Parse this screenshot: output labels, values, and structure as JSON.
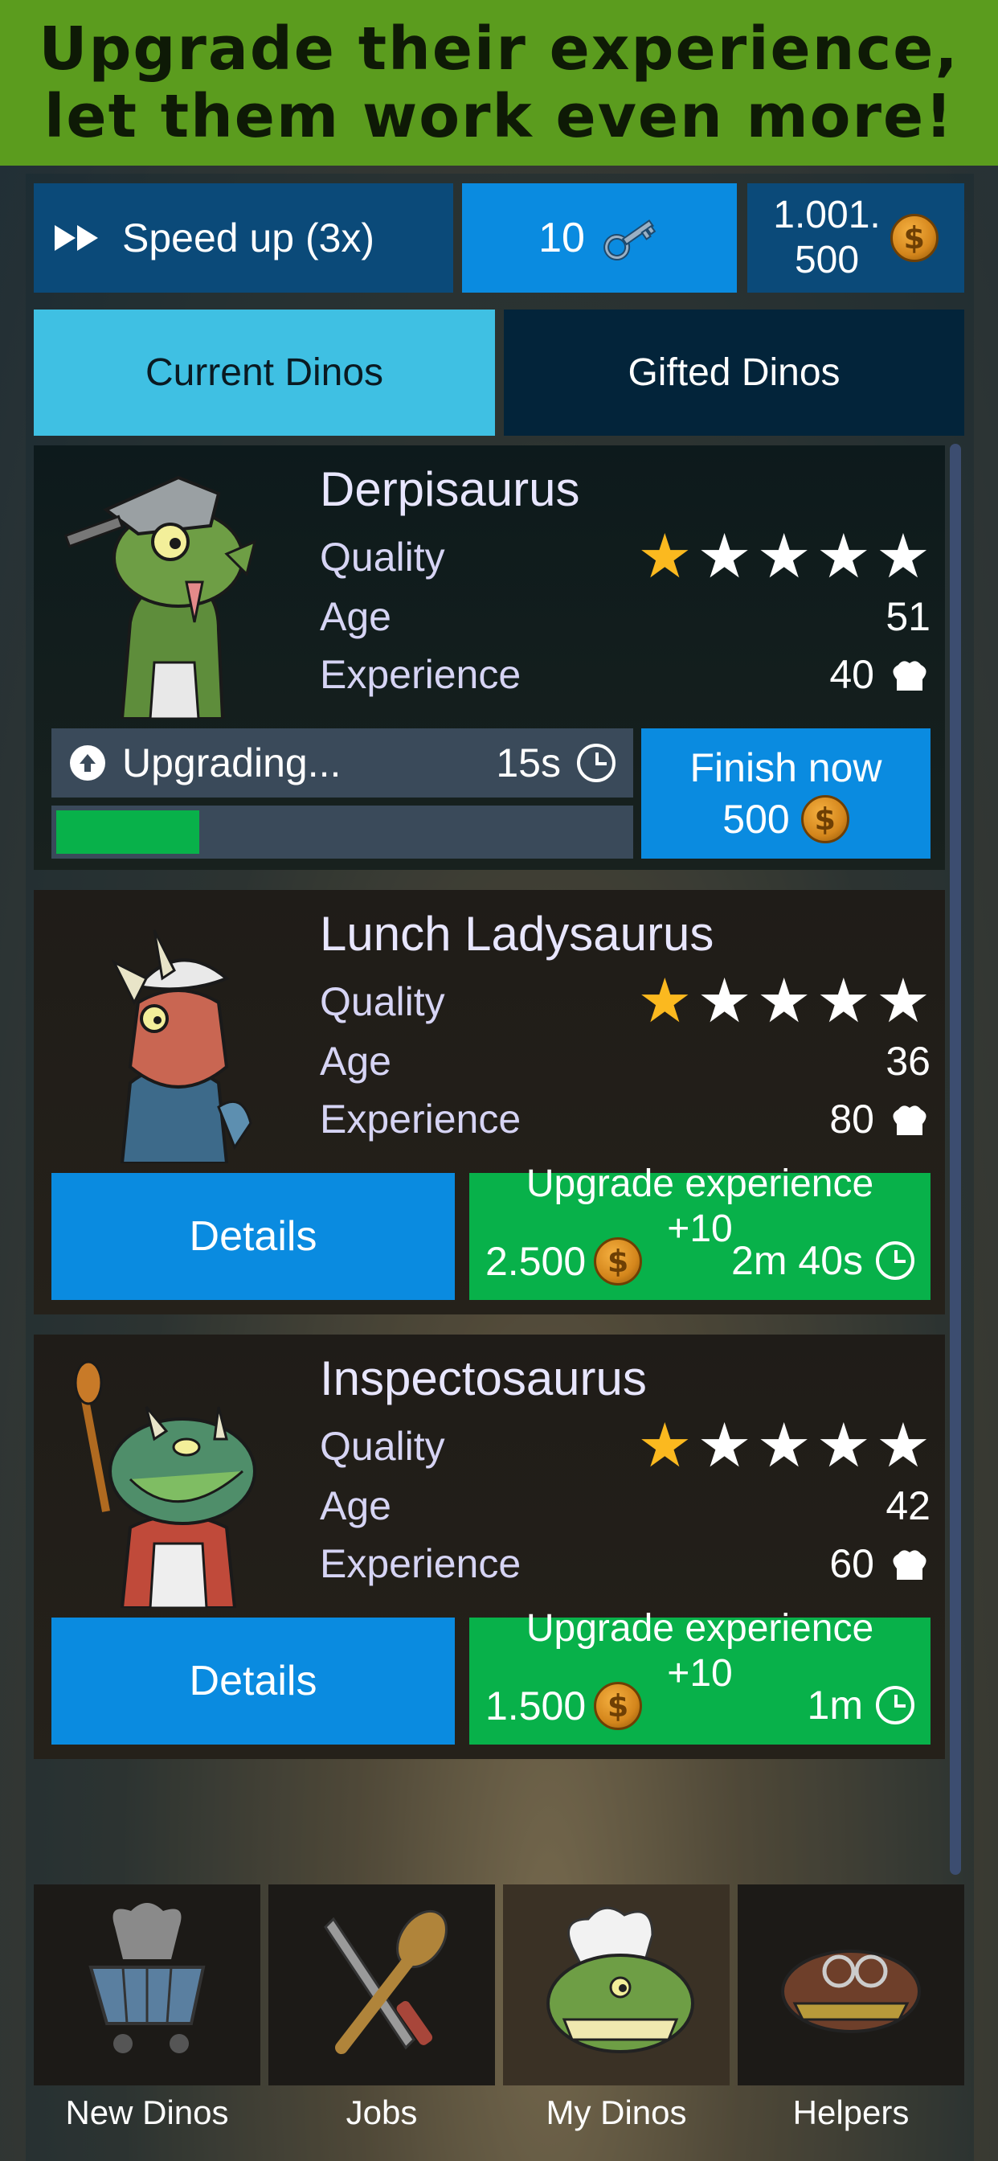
{
  "banner": {
    "line1": "Upgrade their experience,",
    "line2": "let them work even more!"
  },
  "topbar": {
    "speed_label": "Speed up (3x)",
    "keys_count": "10",
    "coins_line1": "1.001.",
    "coins_line2": "500"
  },
  "tabs": [
    {
      "label": "Current Dinos",
      "active": true
    },
    {
      "label": "Gifted Dinos",
      "active": false
    }
  ],
  "labels": {
    "quality": "Quality",
    "age": "Age",
    "experience": "Experience"
  },
  "dinos": [
    {
      "name": "Derpisaurus",
      "quality_stars": 1,
      "max_stars": 5,
      "age": "51",
      "experience": "40",
      "status": {
        "text": "Upgrading...",
        "time": "15s",
        "progress": 0.25
      },
      "finish": {
        "label": "Finish now",
        "cost": "500"
      }
    },
    {
      "name": "Lunch Ladysaurus",
      "quality_stars": 1,
      "max_stars": 5,
      "age": "36",
      "experience": "80",
      "details_label": "Details",
      "upgrade": {
        "title": "Upgrade experience",
        "plus": "+10",
        "cost": "2.500",
        "time": "2m 40s"
      }
    },
    {
      "name": "Inspectosaurus",
      "quality_stars": 1,
      "max_stars": 5,
      "age": "42",
      "experience": "60",
      "details_label": "Details",
      "upgrade": {
        "title": "Upgrade experience",
        "plus": "+10",
        "cost": "1.500",
        "time": "1m"
      }
    }
  ],
  "nav": [
    {
      "label": "New Dinos",
      "icon": "cart-icon"
    },
    {
      "label": "Jobs",
      "icon": "knife-spoon-icon"
    },
    {
      "label": "My Dinos",
      "icon": "dino-chef-icon",
      "active": true
    },
    {
      "label": "Helpers",
      "icon": "dino-glasses-icon"
    }
  ],
  "colors": {
    "banner": "#5b9c1e",
    "primary_blue": "#0a8be0",
    "dark_blue": "#0b4a79",
    "green": "#08b14a",
    "tab_active": "#3fc0e3",
    "star_gold": "#fbb91f"
  }
}
